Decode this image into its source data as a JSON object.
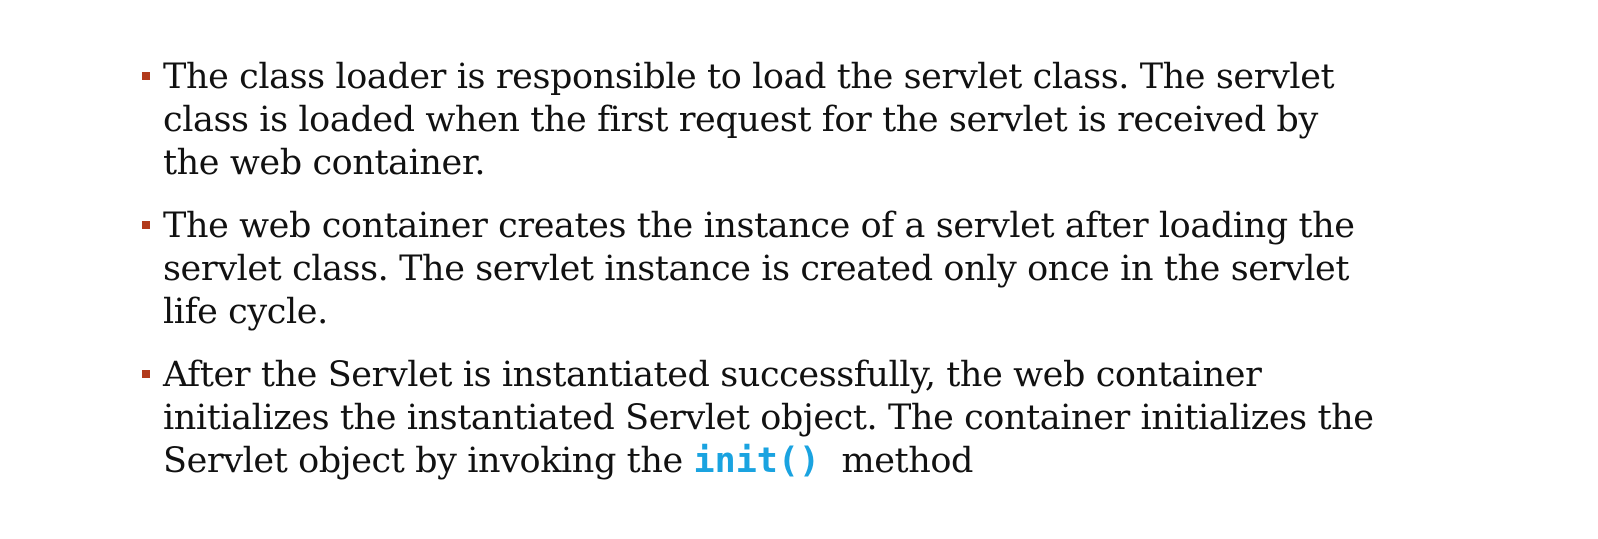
{
  "bullets": [
    {
      "lines": [
        "The class loader is responsible to load the servlet class. The servlet",
        "class is loaded when the first request for the servlet is received by",
        "the web container."
      ]
    },
    {
      "lines": [
        "The web container creates the instance of a servlet after loading the",
        "servlet class. The servlet instance is created only once in the servlet",
        "life cycle."
      ]
    },
    {
      "lines": [
        "After the Servlet is instantiated successfully, the web container",
        "initializes the instantiated Servlet object. The container initializes the"
      ],
      "last_line": {
        "prefix": "Servlet object by invoking the",
        "code": "init()",
        "suffix": "method"
      }
    }
  ],
  "colors": {
    "bullet_marker": "#b23a1c",
    "code": "#1aa3e0",
    "text": "#111111"
  }
}
